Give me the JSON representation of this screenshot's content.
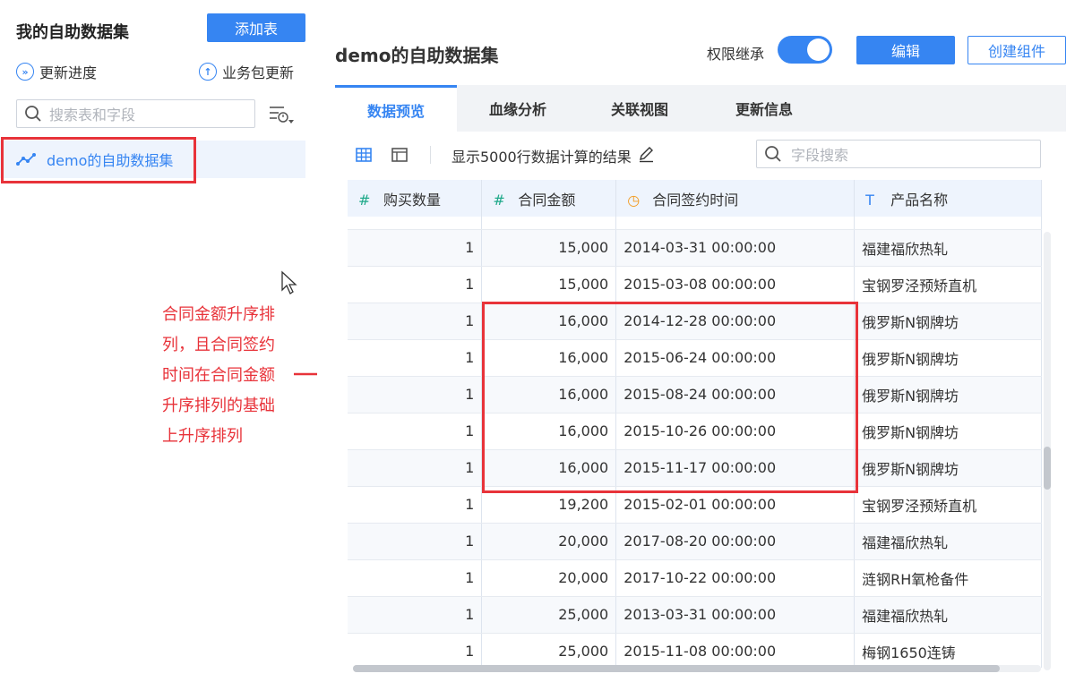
{
  "sidebar": {
    "title": "我的自助数据集",
    "add_table": "添加表",
    "update_progress": "更新进度",
    "package_update": "业务包更新",
    "search_placeholder": "搜索表和字段",
    "dataset": "demo的自助数据集"
  },
  "annotation": {
    "lines": [
      "合同金额升序排",
      "列，且合同签约",
      "时间在合同金额",
      "升序排列的基础",
      "上升序排列"
    ]
  },
  "header": {
    "title": "demo的自助数据集",
    "permission_label": "权限继承",
    "permission_on": true,
    "edit": "编辑",
    "create_component": "创建组件"
  },
  "tabs": [
    "数据预览",
    "血缘分析",
    "关联视图",
    "更新信息"
  ],
  "active_tab": 0,
  "toolbar": {
    "display_text": "显示5000行数据计算的结果",
    "field_search_placeholder": "字段搜索"
  },
  "table": {
    "columns": [
      {
        "icon": "#",
        "name": "购买数量"
      },
      {
        "icon": "#",
        "name": "合同金额"
      },
      {
        "icon": "◷",
        "name": "合同签约时间"
      },
      {
        "icon": "T",
        "name": "产品名称"
      }
    ],
    "rows": [
      [
        "1",
        "15,000",
        "2014-03-31 00:00:00",
        "福建福欣热轧"
      ],
      [
        "1",
        "15,000",
        "2015-03-08 00:00:00",
        "宝钢罗泾预矫直机"
      ],
      [
        "1",
        "16,000",
        "2014-12-28 00:00:00",
        "俄罗斯N钢牌坊"
      ],
      [
        "1",
        "16,000",
        "2015-06-24 00:00:00",
        "俄罗斯N钢牌坊"
      ],
      [
        "1",
        "16,000",
        "2015-08-24 00:00:00",
        "俄罗斯N钢牌坊"
      ],
      [
        "1",
        "16,000",
        "2015-10-26 00:00:00",
        "俄罗斯N钢牌坊"
      ],
      [
        "1",
        "16,000",
        "2015-11-17 00:00:00",
        "俄罗斯N钢牌坊"
      ],
      [
        "1",
        "19,200",
        "2015-02-01 00:00:00",
        "宝钢罗泾预矫直机"
      ],
      [
        "1",
        "20,000",
        "2017-08-20 00:00:00",
        "福建福欣热轧"
      ],
      [
        "1",
        "20,000",
        "2017-10-22 00:00:00",
        "涟钢RH氧枪备件"
      ],
      [
        "1",
        "25,000",
        "2013-03-31 00:00:00",
        "福建福欣热轧"
      ],
      [
        "1",
        "25,000",
        "2015-11-08 00:00:00",
        "梅钢1650连铸"
      ]
    ]
  },
  "colors": {
    "accent": "#3685f2",
    "highlight": "#e8333a",
    "header_bg": "#eef4fd"
  }
}
